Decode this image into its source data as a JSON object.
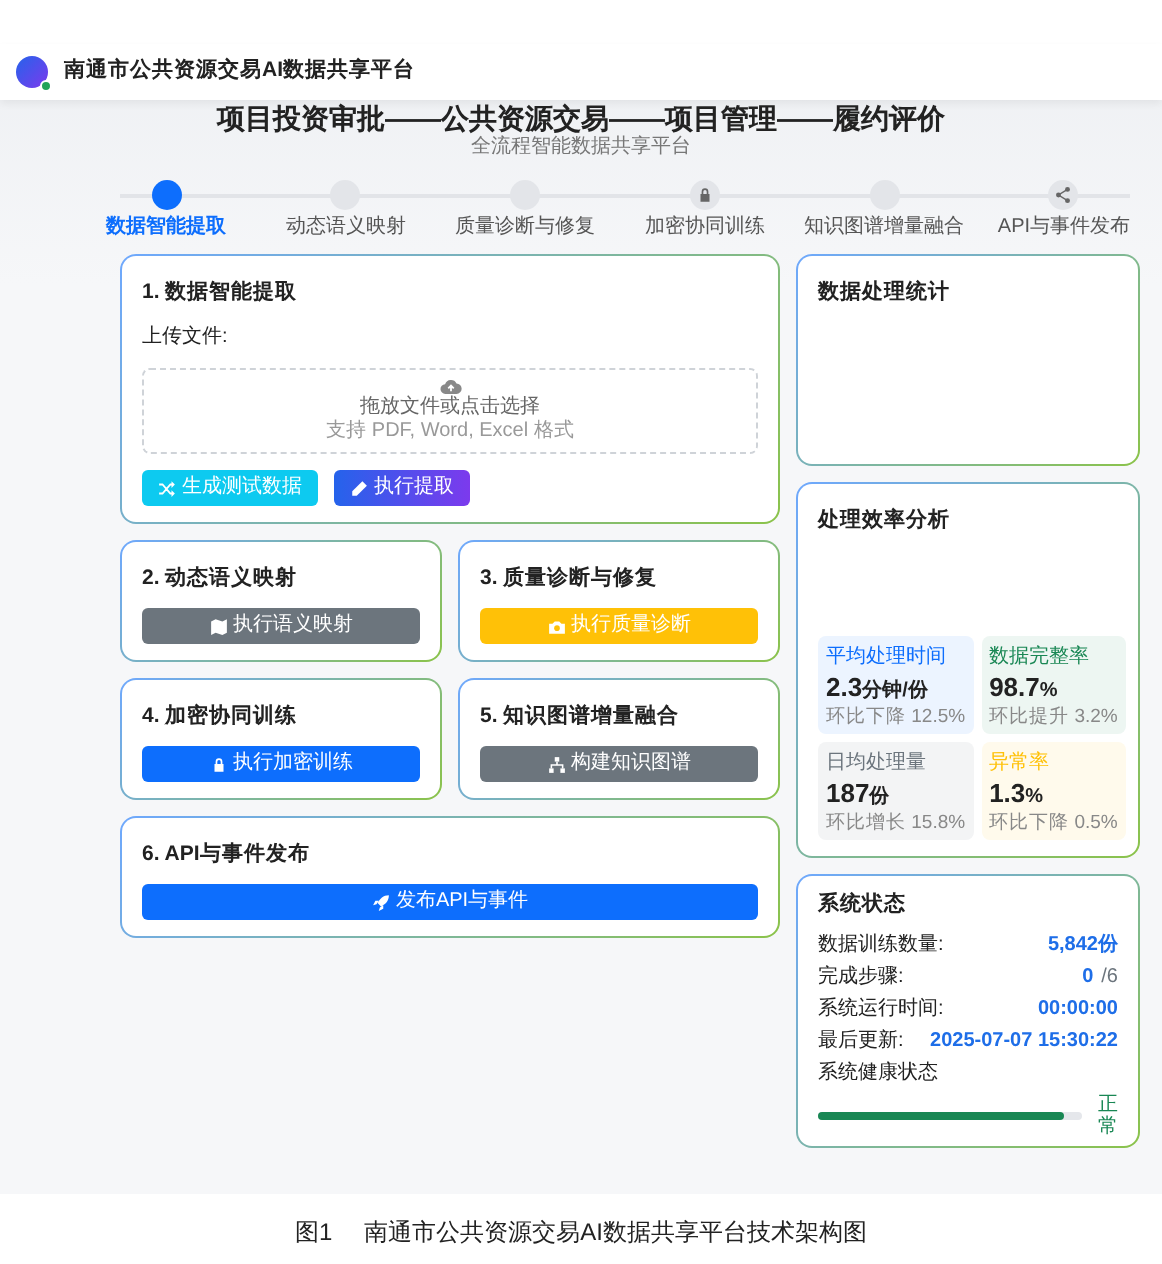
{
  "header": {
    "title": "南通市公共资源交易AI数据共享平台"
  },
  "hero": {
    "title": "项目投资审批——公共资源交易——项目管理——履约评价",
    "subtitle": "全流程智能数据共享平台"
  },
  "steps": [
    {
      "label": "数据智能提取",
      "selected": true,
      "kind": "plain"
    },
    {
      "label": "动态语义映射",
      "selected": false,
      "kind": "plain"
    },
    {
      "label": "质量诊断与修复",
      "selected": false,
      "kind": "plain"
    },
    {
      "label": "加密协同训练",
      "selected": false,
      "kind": "lock"
    },
    {
      "label": "知识图谱增量融合",
      "selected": false,
      "kind": "plain"
    },
    {
      "label": "API与事件发布",
      "selected": false,
      "kind": "share"
    }
  ],
  "modules": [
    {
      "title": "1. 数据智能提取",
      "kind": "wide",
      "upload": {
        "label": "上传文件:",
        "prompt": "拖放文件或点击选择",
        "hint": "支持 PDF, Word, Excel 格式"
      },
      "buttons": [
        {
          "label": "生成测试数据",
          "kind": "info"
        },
        {
          "label": "执行提取",
          "kind": "gradient"
        }
      ]
    },
    {
      "title": "2. 动态语义映射",
      "kind": "half",
      "buttons": [
        {
          "label": "执行语义映射",
          "kind": "secondary"
        }
      ]
    },
    {
      "title": "3. 质量诊断与修复",
      "kind": "half",
      "buttons": [
        {
          "label": "执行质量诊断",
          "kind": "warning"
        }
      ]
    },
    {
      "title": "4. 加密协同训练",
      "kind": "half",
      "buttons": [
        {
          "label": "执行加密训练",
          "kind": "primary"
        }
      ]
    },
    {
      "title": "5. 知识图谱增量融合",
      "kind": "half",
      "buttons": [
        {
          "label": "构建知识图谱",
          "kind": "secondary"
        }
      ]
    },
    {
      "title": "6. API与事件发布",
      "kind": "wide",
      "buttons": [
        {
          "label": "发布API与事件",
          "kind": "primary"
        }
      ]
    }
  ],
  "stats_panel": {
    "title": "数据处理统计"
  },
  "efficiency_panel": {
    "title": "处理效率分析",
    "metrics": [
      {
        "label": "平均处理时间",
        "value": "2.3",
        "unit": "分钟/份",
        "change": "环比下降 12.5%",
        "color": "#0d6efd"
      },
      {
        "label": "数据完整率",
        "value": "98.7",
        "unit": "%",
        "change": "环比提升 3.2%",
        "color": "#198754"
      },
      {
        "label": "日均处理量",
        "value": "187",
        "unit": "份",
        "change": "环比增长 15.8%",
        "color": "#6c757d"
      },
      {
        "label": "异常率",
        "value": "1.3",
        "unit": "%",
        "change": "环比下降 0.5%",
        "color": "#ffc107"
      }
    ]
  },
  "system_status": {
    "title": "系统状态",
    "rows": [
      {
        "label": "数据训练数量:",
        "value": "5,842份"
      },
      {
        "label": "完成步骤:",
        "value": "0",
        "suffix": "/6"
      },
      {
        "label": "系统运行时间:",
        "value": "00:00:00"
      },
      {
        "label": "最后更新:",
        "value": "2025-07-07 15:30:22"
      }
    ],
    "health": {
      "label": "系统健康状态",
      "level": 0.93,
      "reading": "正常"
    }
  },
  "caption": {
    "number": "图1",
    "text": "南通市公共资源交易AI数据共享平台技术架构图"
  }
}
